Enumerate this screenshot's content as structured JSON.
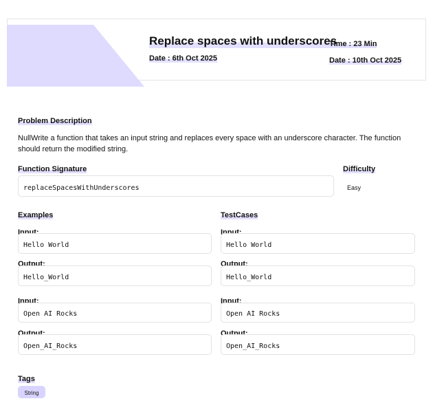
{
  "header": {
    "title": "Replace spaces with underscores",
    "time": "Time : 23 Min",
    "start_date": "Date : 6th Oct 2025",
    "end_date": "Date : 10th Oct 2025"
  },
  "problem": {
    "label": "Problem Description",
    "text": "NullWrite a function that takes an input string and replaces every space with an underscore character. The function should return the modified string."
  },
  "signature": {
    "label": "Function Signature",
    "value": "replaceSpacesWithUnderscores"
  },
  "difficulty": {
    "label": "Difficulty",
    "value": "Easy"
  },
  "examples": {
    "label": "Examples",
    "items": [
      {
        "input_label": "Input:",
        "input": "Hello World",
        "output_label": "Output:",
        "output": "Hello_World"
      },
      {
        "input_label": "Input:",
        "input": "Open AI Rocks",
        "output_label": "Output:",
        "output": "Open_AI_Rocks"
      }
    ]
  },
  "testcases": {
    "label": "TestCases",
    "items": [
      {
        "input_label": "Input:",
        "input": "Hello World",
        "output_label": "Output:",
        "output": "Hello_World"
      },
      {
        "input_label": "Input:",
        "input": "Open AI Rocks",
        "output_label": "Output:",
        "output": "Open_AI_Rocks"
      }
    ]
  },
  "tags": {
    "label": "Tags",
    "items": [
      "String"
    ]
  },
  "colors": {
    "accent_light": "#e3e0ff",
    "header_shape": "#dedbff",
    "tag_bg": "#d9d4ff"
  }
}
